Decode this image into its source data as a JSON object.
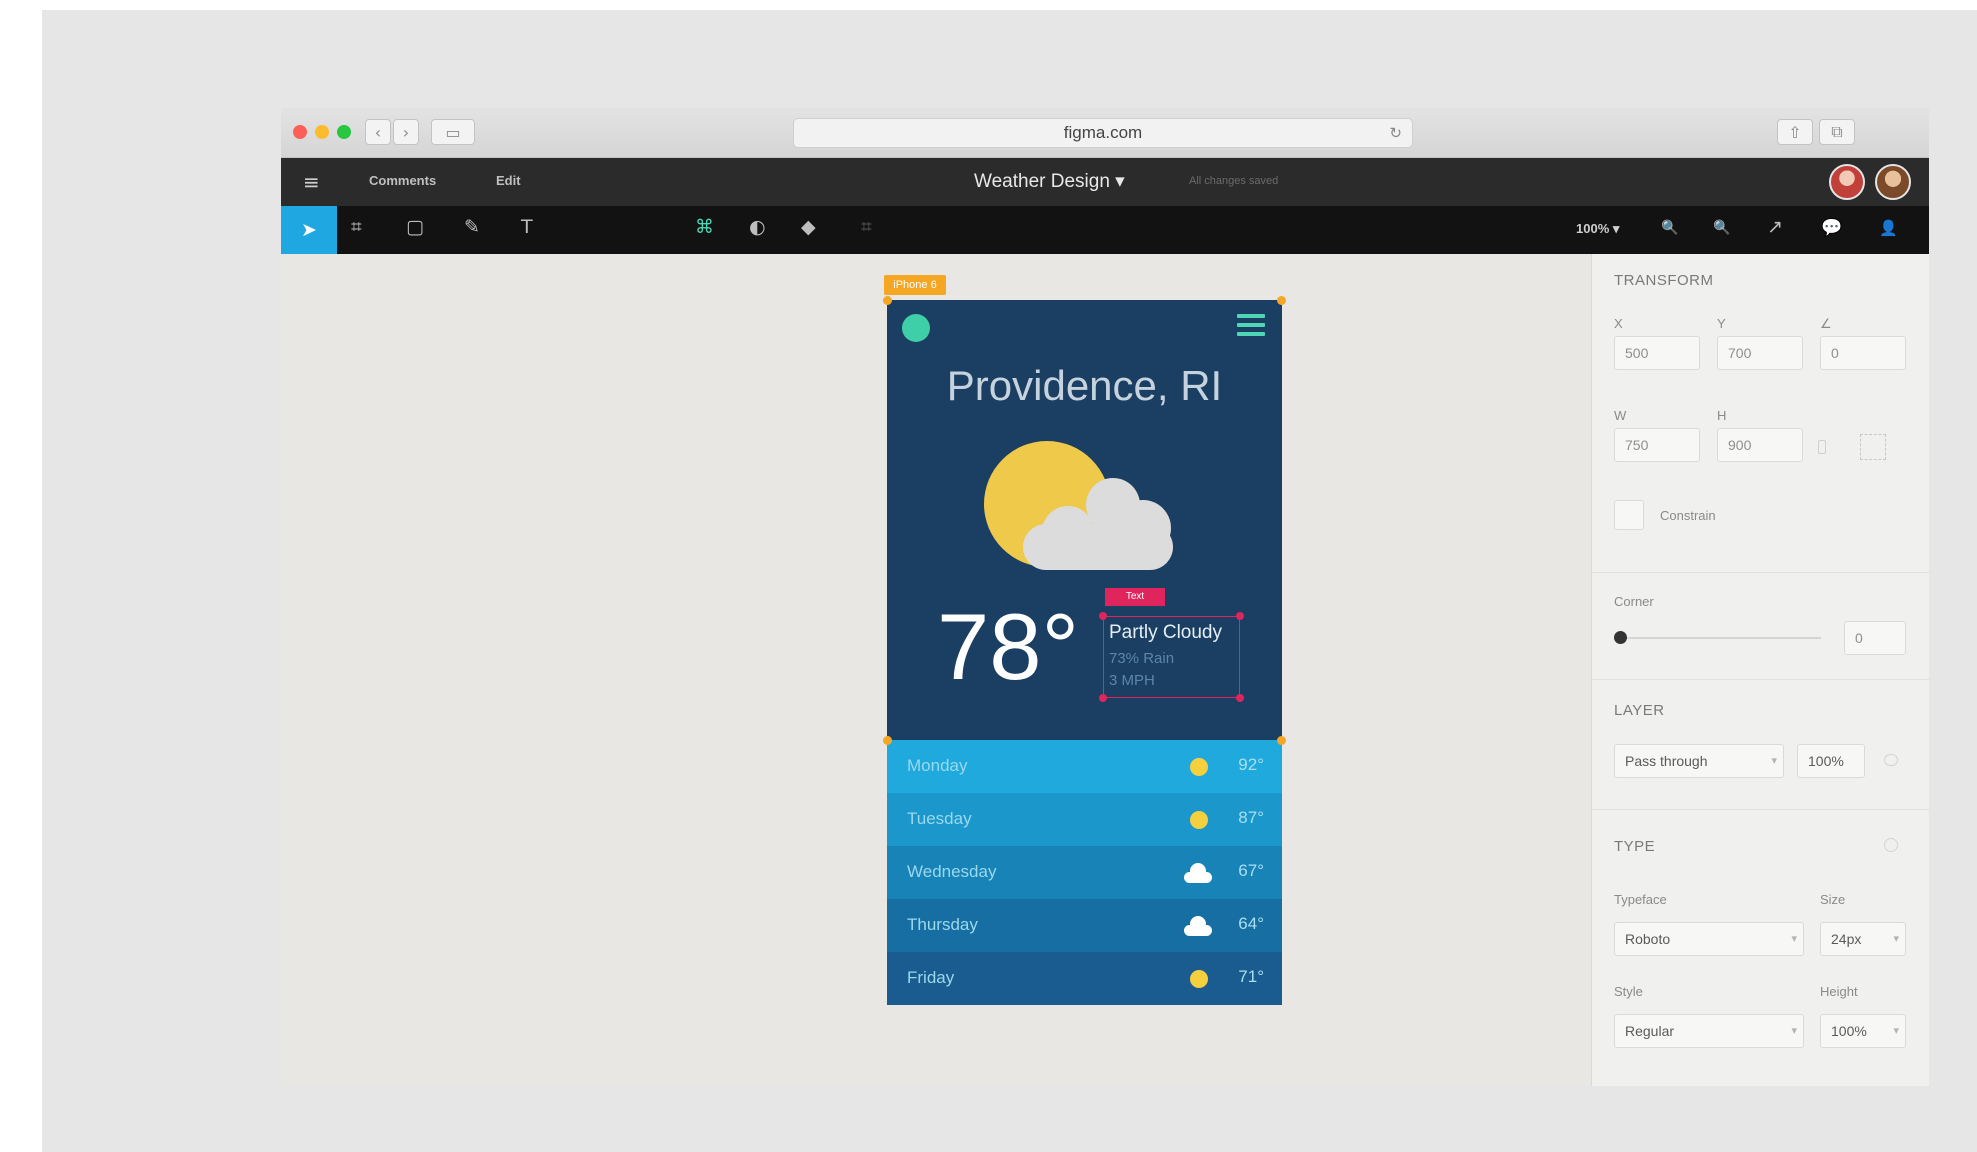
{
  "browser": {
    "url": "figma.com",
    "nav_back": "‹",
    "nav_forward": "›",
    "sidebar_icon": "▭",
    "reload_icon": "↻",
    "share_icon": "⇧",
    "tabs_icon": "⧉"
  },
  "menubar": {
    "menu_icon": "≡",
    "comments_label": "Comments",
    "edit_label": "Edit",
    "document_title": "Weather Design ▾",
    "document_subtitle": "All changes saved"
  },
  "toolbar": {
    "move_tool": "➤",
    "frame_tool": "⌗",
    "shape_tool": "▢",
    "pen_tool": "✎",
    "text_tool": "T",
    "component_tool": "⌘",
    "mask_tool": "◐",
    "boolean_tool": "◆",
    "crop_tool": "⌗",
    "zoom_level": "100% ▾",
    "zoom_out_icon": "🔍",
    "zoom_in_icon": "🔍",
    "prototype_icon": "↗",
    "comment_icon": "💬",
    "user_icon": "👤"
  },
  "canvas": {
    "frame_label": "iPhone 6",
    "app": {
      "city": "Providence, RI",
      "temperature": "78°",
      "description_tag": "Text",
      "condition": "Partly Cloudy",
      "rain_chance": "73% Rain",
      "wind": "3 MPH",
      "forecast": [
        {
          "day": "Monday",
          "temp": "92°",
          "icon": "sun"
        },
        {
          "day": "Tuesday",
          "temp": "87°",
          "icon": "sun"
        },
        {
          "day": "Wednesday",
          "temp": "67°",
          "icon": "cloud"
        },
        {
          "day": "Thursday",
          "temp": "64°",
          "icon": "cloud"
        },
        {
          "day": "Friday",
          "temp": "71°",
          "icon": "sun"
        }
      ]
    }
  },
  "properties": {
    "transform": {
      "title": "TRANSFORM",
      "x_label": "X",
      "x_value": "500",
      "y_label": "Y",
      "y_value": "700",
      "rotation_label": "∠",
      "rotation_value": "0",
      "w_label": "W",
      "w_value": "750",
      "h_label": "H",
      "h_value": "900",
      "constrain_label": "Constrain"
    },
    "corner": {
      "label": "Corner",
      "value": "0"
    },
    "layer": {
      "title": "LAYER",
      "blend_mode": "Pass through",
      "opacity": "100%"
    },
    "type": {
      "title": "TYPE",
      "typeface_label": "Typeface",
      "typeface_value": "Roboto",
      "size_label": "Size",
      "size_value": "24px",
      "style_label": "Style",
      "style_value": "Regular",
      "height_label": "Height",
      "height_value": "100%"
    }
  },
  "colors": {
    "accent_blue": "#1ea7e0",
    "app_navy": "#1b3f62",
    "sun_yellow": "#eec94a",
    "frame_orange": "#f5a623",
    "selection_pink": "#e0245e"
  }
}
